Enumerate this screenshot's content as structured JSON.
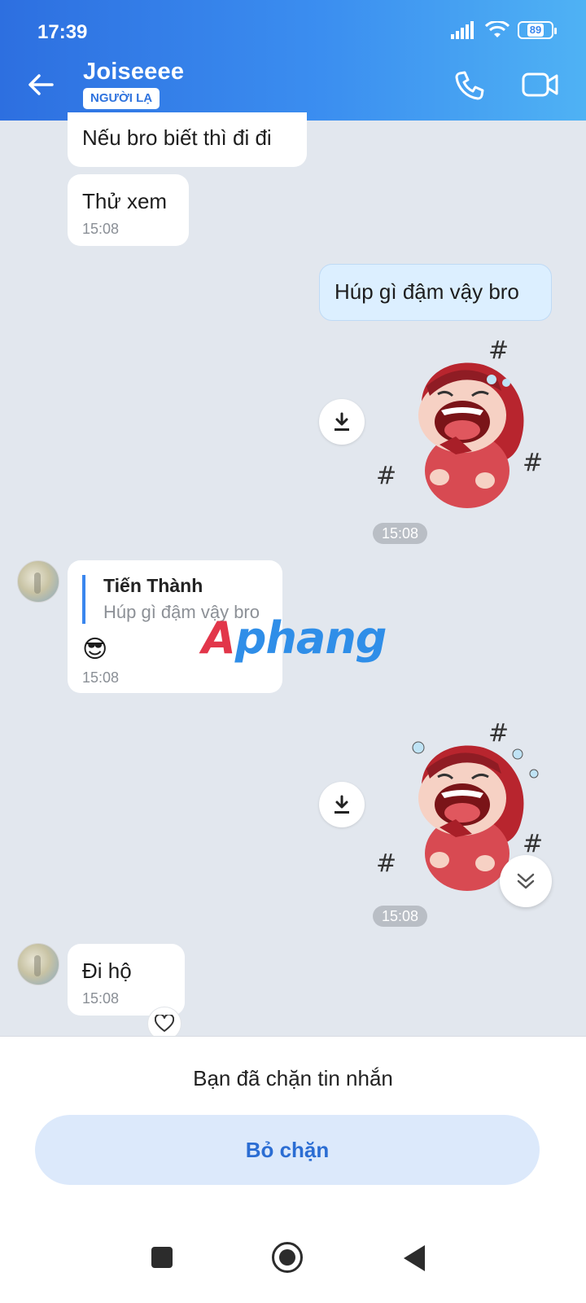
{
  "status_bar": {
    "time": "17:39",
    "battery": "89"
  },
  "header": {
    "name": "Joiseeee",
    "badge": "NGƯỜI LẠ"
  },
  "messages": [
    {
      "text": "Nếu bro biết thì đi đi"
    },
    {
      "text": "Thử xem",
      "time": "15:08"
    },
    {
      "text": "Húp gì đậm vậy bro"
    },
    {
      "time": "15:08"
    },
    {
      "reply_author": "Tiến Thành",
      "reply_text": "Húp gì đậm vậy bro",
      "emoji": "😎",
      "time": "15:08"
    },
    {
      "time": "15:08"
    },
    {
      "text": "Đi hộ",
      "time": "15:08"
    }
  ],
  "watermark": {
    "part1": "A",
    "part2": "phang"
  },
  "footer": {
    "blocked_text": "Bạn đã chặn tin nhắn",
    "unblock_label": "Bỏ chặn"
  },
  "colors": {
    "header_start": "#2d6fe0",
    "header_end": "#4fb2f4",
    "accent": "#2b6dd3",
    "my_bubble": "#dcefff"
  }
}
